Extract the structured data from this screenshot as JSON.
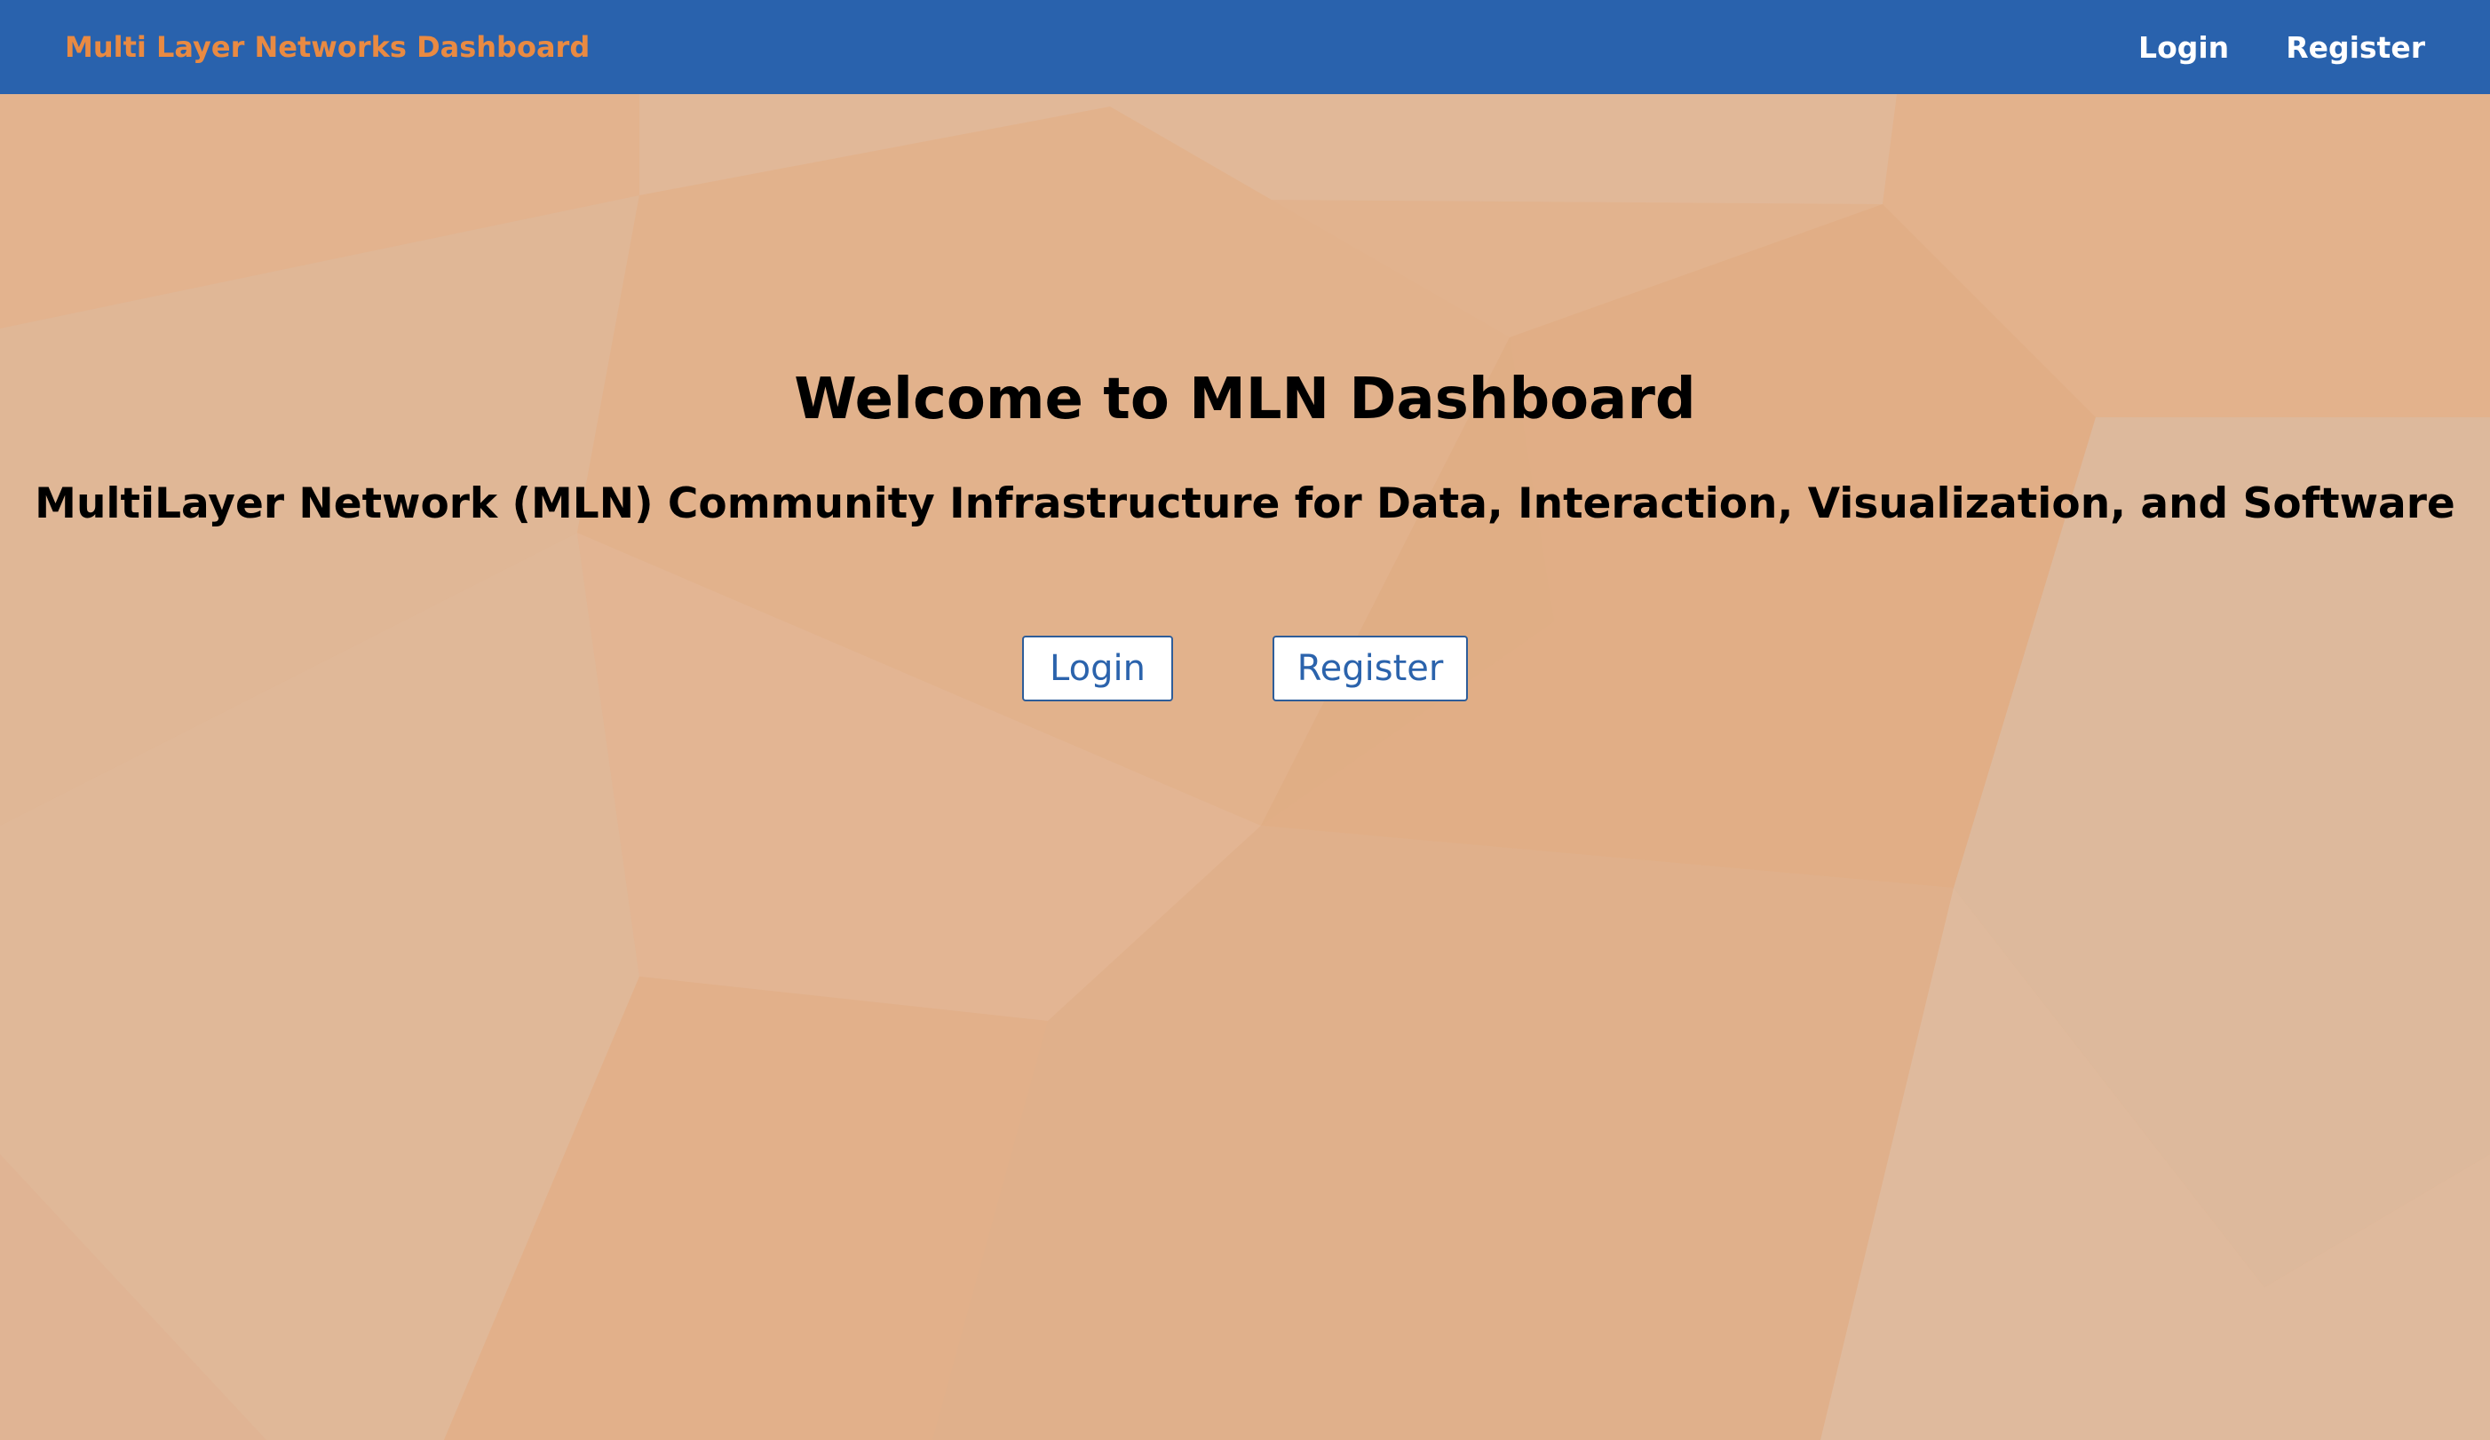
{
  "navbar": {
    "brand": "Multi Layer Networks Dashboard",
    "links": [
      {
        "label": "Login"
      },
      {
        "label": "Register"
      }
    ]
  },
  "hero": {
    "title": "Welcome to MLN Dashboard",
    "subtitle": "MultiLayer Network (MLN) Community Infrastructure for Data, Interaction, Visualization, and Software",
    "buttons": [
      {
        "label": "Login"
      },
      {
        "label": "Register"
      }
    ]
  },
  "colors": {
    "navbar_bg": "#2962ad",
    "brand_text": "#e98a42",
    "background": "#e2b38e",
    "button_text": "#2b63ac"
  }
}
